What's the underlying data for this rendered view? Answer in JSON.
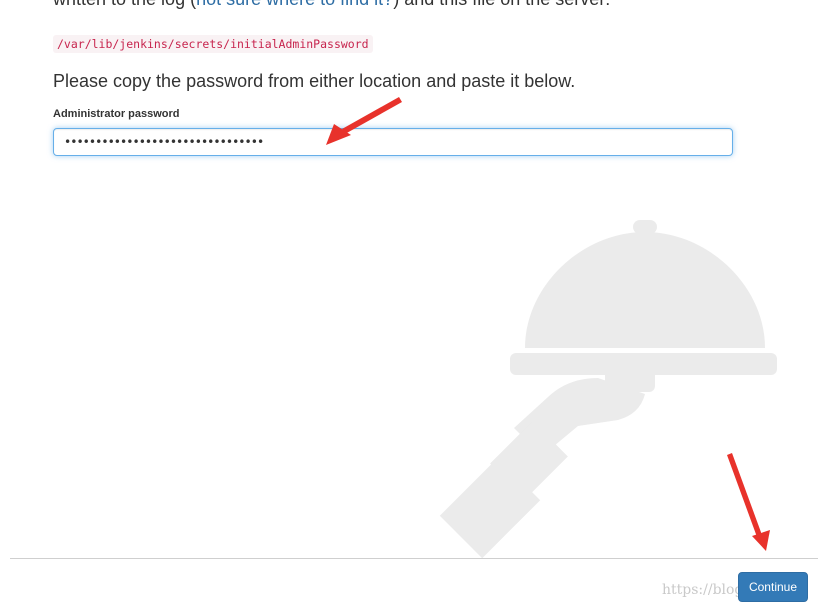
{
  "intro": {
    "before_link": "written to the log (",
    "link_text": "not sure where to find it?",
    "after_link": ") and this file on the server:"
  },
  "secret_path": "/var/lib/jenkins/secrets/initialAdminPassword",
  "instruction": "Please copy the password from either location and paste it below.",
  "password_field": {
    "label": "Administrator password",
    "masked_value": "••••••••••••••••••••••••••••••••"
  },
  "footer": {
    "continue_label": "Continue",
    "watermark": "https://blog.csdn.n"
  },
  "icons": [
    "serving-dish-icon",
    "red-arrow-icon"
  ],
  "colors": {
    "accent": "#337ab7",
    "link": "#2e6da4",
    "code_text": "#c7254e",
    "code_bg": "#f9f2f4",
    "focus_border": "#66afe9",
    "annotation_arrow": "#e8322b",
    "illustration": "#ebebeb"
  }
}
